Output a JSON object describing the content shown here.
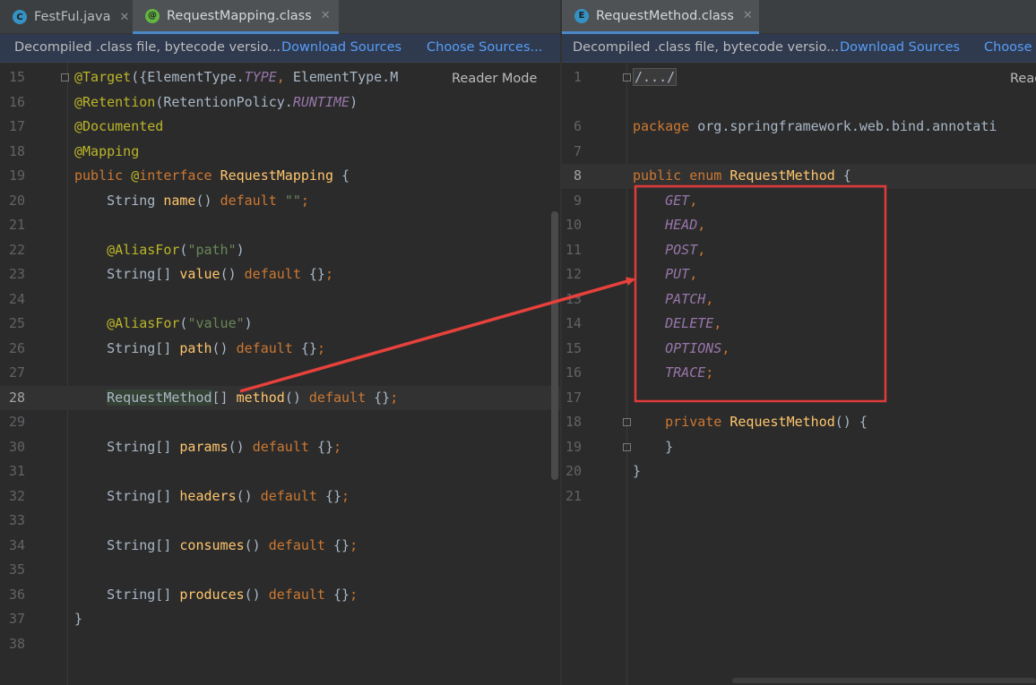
{
  "left": {
    "tabs": [
      {
        "icon_letter": "C",
        "icon_color": "#3592c4",
        "label": "FestFul.java",
        "active": false
      },
      {
        "icon_letter": "@",
        "icon_color": "#62b543",
        "label": "RequestMapping.class",
        "active": true
      }
    ],
    "banner": {
      "message": "Decompiled .class file, bytecode versio...",
      "download_sources": "Download Sources",
      "choose_sources": "Choose Sources..."
    },
    "reader_mode": "Reader Mode",
    "current_line": "28",
    "lines": [
      {
        "n": "15",
        "t": [
          [
            "ann",
            "@Target"
          ],
          [
            "txt",
            "({ElementType."
          ],
          [
            "cst",
            "TYPE"
          ],
          [
            "kw",
            ", "
          ],
          [
            "txt",
            "ElementType.M"
          ]
        ]
      },
      {
        "n": "16",
        "t": [
          [
            "ann",
            "@Retention"
          ],
          [
            "txt",
            "(RetentionPolicy."
          ],
          [
            "cst",
            "RUNTIME"
          ],
          [
            "txt",
            ")"
          ]
        ]
      },
      {
        "n": "17",
        "t": [
          [
            "ann",
            "@Documented"
          ]
        ]
      },
      {
        "n": "18",
        "t": [
          [
            "ann",
            "@Mapping"
          ]
        ]
      },
      {
        "n": "19",
        "t": [
          [
            "kw",
            "public "
          ],
          [
            "ann",
            "@"
          ],
          [
            "kw",
            "interface "
          ],
          [
            "fn",
            "RequestMapping"
          ],
          [
            "txt",
            " {"
          ]
        ]
      },
      {
        "n": "20",
        "t": [
          [
            "txt",
            "    String "
          ],
          [
            "fn",
            "name"
          ],
          [
            "txt",
            "() "
          ],
          [
            "kw",
            "default "
          ],
          [
            "str",
            "\"\""
          ],
          [
            "kw",
            ";"
          ]
        ]
      },
      {
        "n": "21",
        "t": []
      },
      {
        "n": "22",
        "t": [
          [
            "ann",
            "    @AliasFor"
          ],
          [
            "txt",
            "("
          ],
          [
            "str",
            "\"path\""
          ],
          [
            "txt",
            ")"
          ]
        ]
      },
      {
        "n": "23",
        "t": [
          [
            "txt",
            "    String[] "
          ],
          [
            "fn",
            "value"
          ],
          [
            "txt",
            "() "
          ],
          [
            "kw",
            "default "
          ],
          [
            "txt",
            "{}"
          ],
          [
            "kw",
            ";"
          ]
        ]
      },
      {
        "n": "24",
        "t": []
      },
      {
        "n": "25",
        "t": [
          [
            "ann",
            "    @AliasFor"
          ],
          [
            "txt",
            "("
          ],
          [
            "str",
            "\"value\""
          ],
          [
            "txt",
            ")"
          ]
        ]
      },
      {
        "n": "26",
        "t": [
          [
            "txt",
            "    String[] "
          ],
          [
            "fn",
            "path"
          ],
          [
            "txt",
            "() "
          ],
          [
            "kw",
            "default "
          ],
          [
            "txt",
            "{}"
          ],
          [
            "kw",
            ";"
          ]
        ]
      },
      {
        "n": "27",
        "t": []
      },
      {
        "n": "28",
        "t": [
          [
            "txt",
            "    "
          ],
          [
            "usage",
            "RequestMethod"
          ],
          [
            "txt",
            "[] "
          ],
          [
            "fn",
            "method"
          ],
          [
            "txt",
            "() "
          ],
          [
            "kw",
            "default "
          ],
          [
            "txt",
            "{}"
          ],
          [
            "kw",
            ";"
          ]
        ]
      },
      {
        "n": "29",
        "t": []
      },
      {
        "n": "30",
        "t": [
          [
            "txt",
            "    String[] "
          ],
          [
            "fn",
            "params"
          ],
          [
            "txt",
            "() "
          ],
          [
            "kw",
            "default "
          ],
          [
            "txt",
            "{}"
          ],
          [
            "kw",
            ";"
          ]
        ]
      },
      {
        "n": "31",
        "t": []
      },
      {
        "n": "32",
        "t": [
          [
            "txt",
            "    String[] "
          ],
          [
            "fn",
            "headers"
          ],
          [
            "txt",
            "() "
          ],
          [
            "kw",
            "default "
          ],
          [
            "txt",
            "{}"
          ],
          [
            "kw",
            ";"
          ]
        ]
      },
      {
        "n": "33",
        "t": []
      },
      {
        "n": "34",
        "t": [
          [
            "txt",
            "    String[] "
          ],
          [
            "fn",
            "consumes"
          ],
          [
            "txt",
            "() "
          ],
          [
            "kw",
            "default "
          ],
          [
            "txt",
            "{}"
          ],
          [
            "kw",
            ";"
          ]
        ]
      },
      {
        "n": "35",
        "t": []
      },
      {
        "n": "36",
        "t": [
          [
            "txt",
            "    String[] "
          ],
          [
            "fn",
            "produces"
          ],
          [
            "txt",
            "() "
          ],
          [
            "kw",
            "default "
          ],
          [
            "txt",
            "{}"
          ],
          [
            "kw",
            ";"
          ]
        ]
      },
      {
        "n": "37",
        "t": [
          [
            "txt",
            "}"
          ]
        ]
      },
      {
        "n": "38",
        "t": []
      }
    ]
  },
  "right": {
    "tabs": [
      {
        "icon_letter": "E",
        "icon_color": "#3592c4",
        "label": "RequestMethod.class",
        "active": true
      }
    ],
    "banner": {
      "message": "Decompiled .class file, bytecode versio...",
      "download_sources": "Download Sources",
      "choose_sources": "Choose"
    },
    "reader_mode": "Read",
    "current_line": "8",
    "lines": [
      {
        "n": "1",
        "t": [
          [
            "collapsed",
            "/.../"
          ]
        ]
      },
      {
        "n": "",
        "t": []
      },
      {
        "n": "6",
        "t": [
          [
            "kw",
            "package "
          ],
          [
            "txt",
            "org.springframework.web.bind.annotati"
          ]
        ]
      },
      {
        "n": "7",
        "t": []
      },
      {
        "n": "8",
        "t": [
          [
            "kw",
            "public enum "
          ],
          [
            "fn",
            "RequestMethod"
          ],
          [
            "txt",
            " {"
          ]
        ]
      },
      {
        "n": "9",
        "t": [
          [
            "cst",
            "    GET"
          ],
          [
            "kw",
            ","
          ]
        ]
      },
      {
        "n": "10",
        "t": [
          [
            "cst",
            "    HEAD"
          ],
          [
            "kw",
            ","
          ]
        ]
      },
      {
        "n": "11",
        "t": [
          [
            "cst",
            "    POST"
          ],
          [
            "kw",
            ","
          ]
        ]
      },
      {
        "n": "12",
        "t": [
          [
            "cst",
            "    PUT"
          ],
          [
            "kw",
            ","
          ]
        ]
      },
      {
        "n": "13",
        "t": [
          [
            "cst",
            "    PATCH"
          ],
          [
            "kw",
            ","
          ]
        ]
      },
      {
        "n": "14",
        "t": [
          [
            "cst",
            "    DELETE"
          ],
          [
            "kw",
            ","
          ]
        ]
      },
      {
        "n": "15",
        "t": [
          [
            "cst",
            "    OPTIONS"
          ],
          [
            "kw",
            ","
          ]
        ]
      },
      {
        "n": "16",
        "t": [
          [
            "cst",
            "    TRACE"
          ],
          [
            "kw",
            ";"
          ]
        ]
      },
      {
        "n": "17",
        "t": []
      },
      {
        "n": "18",
        "t": [
          [
            "kw",
            "    private "
          ],
          [
            "fn",
            "RequestMethod"
          ],
          [
            "txt",
            "() {"
          ]
        ]
      },
      {
        "n": "19",
        "t": [
          [
            "txt",
            "    }"
          ]
        ]
      },
      {
        "n": "20",
        "t": [
          [
            "txt",
            "}"
          ]
        ]
      },
      {
        "n": "21",
        "t": []
      }
    ]
  },
  "annotation": {
    "box_color": "#e03b3b",
    "arrow_color": "#e8413c"
  }
}
